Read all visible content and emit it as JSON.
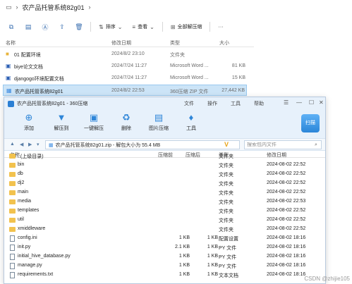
{
  "explorer": {
    "title": "农产品托管系统82g01",
    "toolbar": {
      "sort_label": "排序",
      "view_label": "查看",
      "select_all_label": "全部解压缩",
      "more_label": "···"
    },
    "columns": {
      "name": "名称",
      "date": "修改日期",
      "type": "类型",
      "size": "大小"
    },
    "rows": [
      {
        "name": "01 配置环境",
        "date": "2024/8/2 23:10",
        "type": "文件夹",
        "size": ""
      },
      {
        "name": "biye论文文档",
        "date": "2024/7/24 11:27",
        "type": "Microsoft Word ...",
        "size": "81 KB"
      },
      {
        "name": "djangogo环境配置文档",
        "date": "2024/7/24 11:27",
        "type": "Microsoft Word ...",
        "size": "15 KB"
      },
      {
        "name": "农产品托管系统82g01",
        "date": "2024/8/2 22:53",
        "type": "360压缩 ZIP 文件",
        "size": "27,442 KB"
      }
    ]
  },
  "zip": {
    "title": "农产品托管系统82g01 - 360压缩",
    "menu": [
      "文件",
      "操作",
      "工具",
      "帮助"
    ],
    "ribbon": [
      {
        "label": "添加",
        "icon": "add-icon"
      },
      {
        "label": "解压到",
        "icon": "extract-icon"
      },
      {
        "label": "一键解压",
        "icon": "one-click-extract-icon"
      },
      {
        "label": "删除",
        "icon": "delete-icon"
      },
      {
        "label": "图片压缩",
        "icon": "image-compress-icon"
      },
      {
        "label": "工具",
        "icon": "tools-icon"
      }
    ],
    "scan_label": "扫描",
    "address": "农产品托管系统82g01.zip - 解包大小为 55.4 MB",
    "search_placeholder": "搜索包内文件",
    "columns": {
      "name": "名称",
      "compressed": "压缩前",
      "after": "压缩后",
      "type": "类型",
      "modified": "修改日期"
    },
    "rows": [
      {
        "name": "..(上级目录)",
        "c1": "",
        "c2": "",
        "type": "文件夹",
        "date": "",
        "kind": "folder"
      },
      {
        "name": "bin",
        "c1": "",
        "c2": "",
        "type": "文件夹",
        "date": "2024-08-02 22:52",
        "kind": "folder"
      },
      {
        "name": "db",
        "c1": "",
        "c2": "",
        "type": "文件夹",
        "date": "2024-08-02 22:52",
        "kind": "folder"
      },
      {
        "name": "dj2",
        "c1": "",
        "c2": "",
        "type": "文件夹",
        "date": "2024-08-02 22:52",
        "kind": "folder"
      },
      {
        "name": "main",
        "c1": "",
        "c2": "",
        "type": "文件夹",
        "date": "2024-08-02 22:52",
        "kind": "folder"
      },
      {
        "name": "media",
        "c1": "",
        "c2": "",
        "type": "文件夹",
        "date": "2024-08-02 22:53",
        "kind": "folder"
      },
      {
        "name": "templates",
        "c1": "",
        "c2": "",
        "type": "文件夹",
        "date": "2024-08-02 22:52",
        "kind": "folder"
      },
      {
        "name": "util",
        "c1": "",
        "c2": "",
        "type": "文件夹",
        "date": "2024-08-02 22:52",
        "kind": "folder"
      },
      {
        "name": "xmiddleware",
        "c1": "",
        "c2": "",
        "type": "文件夹",
        "date": "2024-08-02 22:52",
        "kind": "folder"
      },
      {
        "name": "config.ini",
        "c1": "1 KB",
        "c2": "1 KB",
        "type": "配置设置",
        "date": "2024-08-02 18:16",
        "kind": "file"
      },
      {
        "name": "init.py",
        "c1": "2.1 KB",
        "c2": "1 KB",
        "type": "PY 文件",
        "date": "2024-08-02 18:16",
        "kind": "file"
      },
      {
        "name": "initial_hive_database.py",
        "c1": "1 KB",
        "c2": "1 KB",
        "type": "PY 文件",
        "date": "2024-08-02 18:16",
        "kind": "file"
      },
      {
        "name": "manage.py",
        "c1": "1 KB",
        "c2": "1 KB",
        "type": "PY 文件",
        "date": "2024-08-02 18:16",
        "kind": "file"
      },
      {
        "name": "requirements.txt",
        "c1": "1 KB",
        "c2": "1 KB",
        "type": "文本文档",
        "date": "2024-08-02 18:16",
        "kind": "file"
      }
    ]
  },
  "watermark": "CSDN @zhijie105"
}
